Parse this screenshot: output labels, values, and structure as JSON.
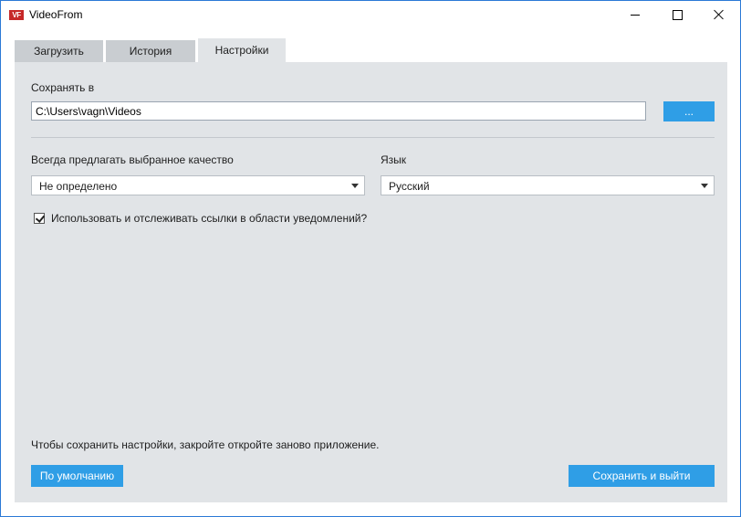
{
  "window": {
    "title": "VideoFrom",
    "icon_text": "VF",
    "controls": [
      "minimize-icon",
      "maximize-icon",
      "close-icon"
    ]
  },
  "tabs": [
    {
      "label": "Загрузить",
      "active": false
    },
    {
      "label": "История",
      "active": false
    },
    {
      "label": "Настройки",
      "active": true
    }
  ],
  "settings": {
    "save_to_label": "Сохранять в",
    "save_path": "C:\\Users\\vagn\\Videos",
    "browse_label": "...",
    "quality_label": "Всегда предлагать выбранное качество",
    "quality_value": "Не определено",
    "language_label": "Язык",
    "language_value": "Русский",
    "tray_checkbox_label": "Использовать и отслеживать ссылки в области уведомлений?",
    "tray_checkbox_checked": true,
    "restart_note": "Чтобы сохранить настройки, закройте  откройте заново приложение.",
    "default_button": "По умолчанию",
    "save_exit_button": "Сохранить и выйти"
  },
  "colors": {
    "accent": "#2f9ee6",
    "panel_bg": "#e1e4e7",
    "tab_inactive": "#c9cdd1",
    "window_border": "#2b79d6"
  }
}
